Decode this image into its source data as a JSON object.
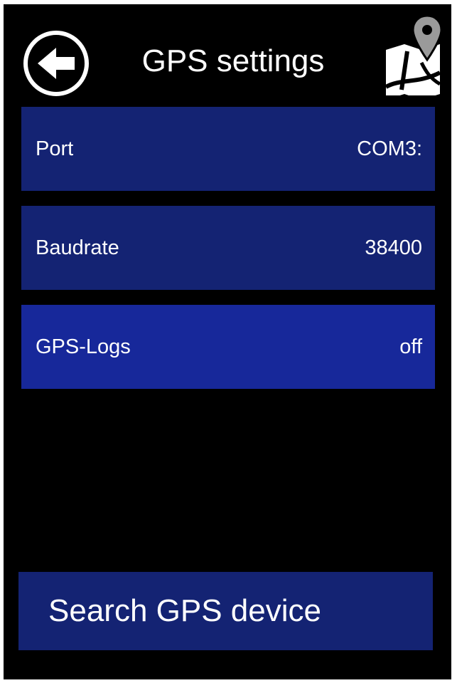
{
  "header": {
    "title": "GPS settings",
    "back_icon": "back-arrow-icon",
    "map_icon": "map-pin-icon"
  },
  "settings": [
    {
      "label": "Port",
      "value": "COM3:"
    },
    {
      "label": "Baudrate",
      "value": "38400"
    },
    {
      "label": "GPS-Logs",
      "value": "off"
    }
  ],
  "actions": {
    "search_label": "Search GPS device"
  },
  "colors": {
    "background": "#000000",
    "row": "#142373",
    "row_highlight": "#17289a",
    "text": "#ffffff"
  }
}
